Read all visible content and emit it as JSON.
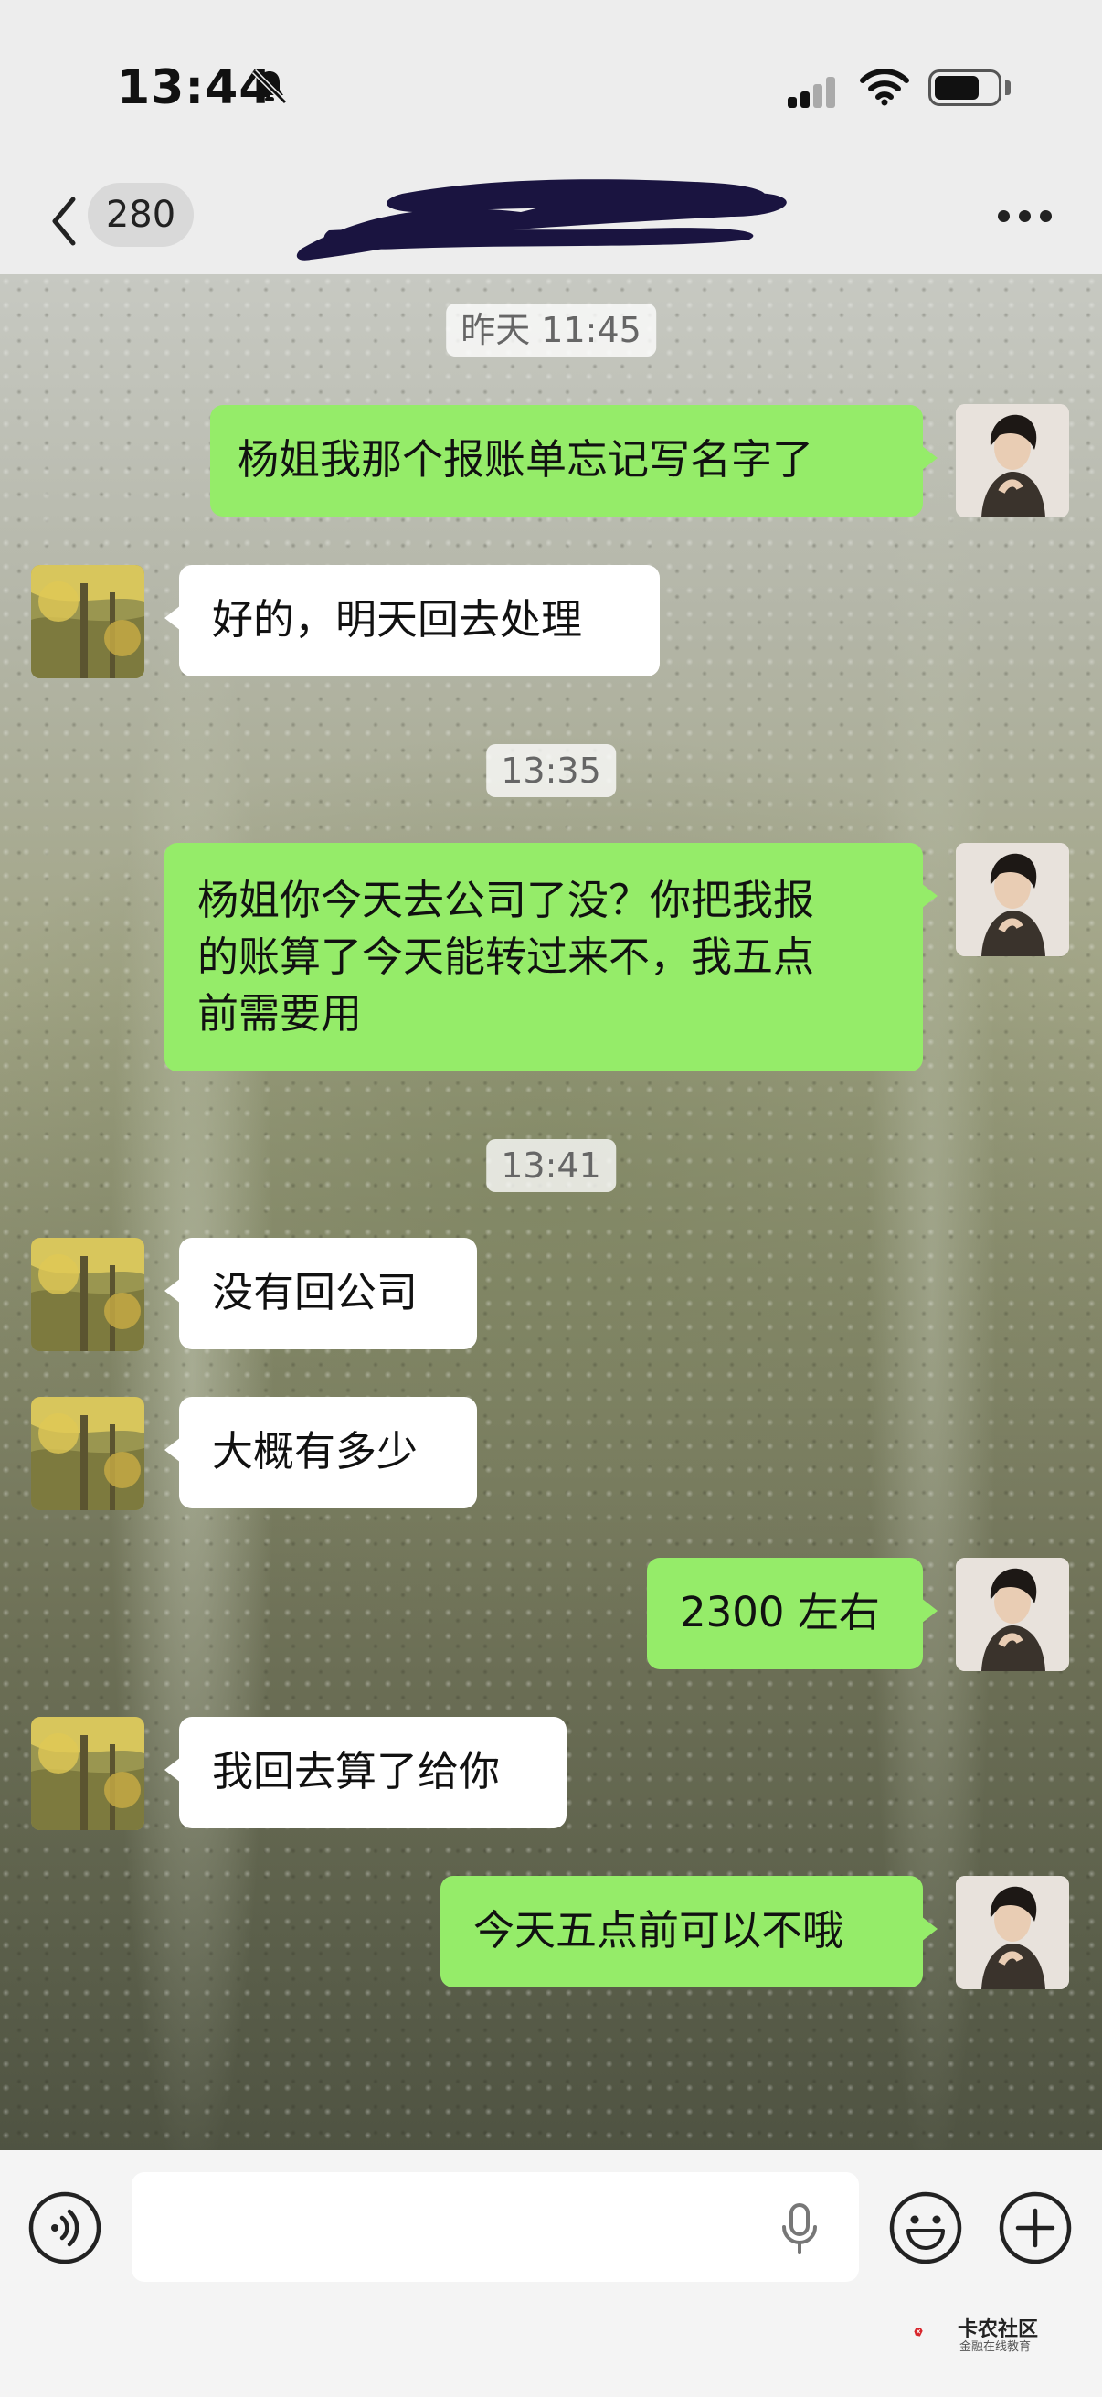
{
  "status_bar": {
    "time": "13:44"
  },
  "nav": {
    "unread_count": "280"
  },
  "messages": [
    {
      "type": "time",
      "text": "昨天 11:45"
    },
    {
      "type": "sent",
      "text": "杨姐我那个报账单忘记写名字了"
    },
    {
      "type": "received",
      "text": "好的，明天回去处理"
    },
    {
      "type": "time",
      "text": "13:35"
    },
    {
      "type": "sent",
      "lines": [
        "杨姐你今天去公司了没？你把我报",
        "的账算了今天能转过来不，我五点",
        "前需要用"
      ]
    },
    {
      "type": "time",
      "text": "13:41"
    },
    {
      "type": "received",
      "text": "没有回公司"
    },
    {
      "type": "received",
      "text": "大概有多少"
    },
    {
      "type": "sent",
      "text": "2300 左右"
    },
    {
      "type": "received",
      "text": "我回去算了给你"
    },
    {
      "type": "sent",
      "text": "今天五点前可以不哦"
    }
  ],
  "input": {
    "value": ""
  },
  "watermark": {
    "brand": "卡农社区",
    "tagline": "金融在线教育"
  },
  "colors": {
    "sent_bubble": "#95ec69",
    "received_bubble": "#ffffff",
    "bar_bg": "#ededed"
  }
}
